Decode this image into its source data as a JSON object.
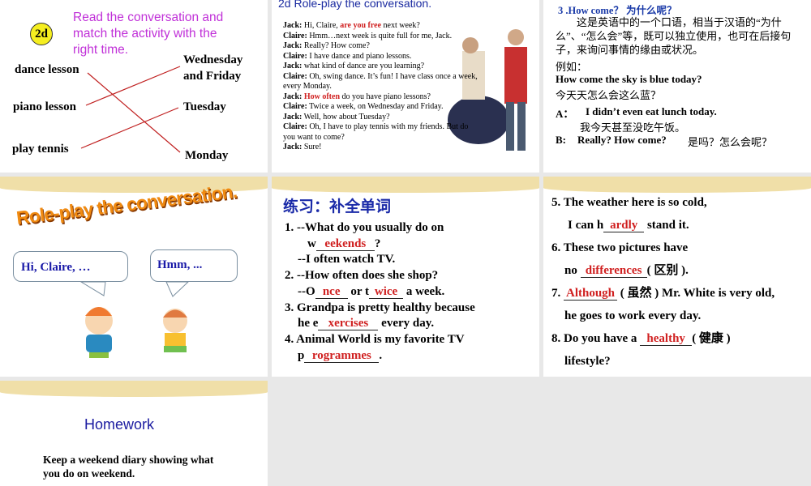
{
  "slide1": {
    "badge": "2d",
    "instruction": "Read the conversation and match the activity with the right time.",
    "activities": [
      "dance lesson",
      "piano lesson",
      "play tennis"
    ],
    "times": [
      "Wednesday and Friday",
      "Tuesday",
      "Monday"
    ]
  },
  "slide2": {
    "title": "2d Role-play the conversation.",
    "lines": [
      {
        "speaker": "Jack:",
        "pre": " Hi, Claire, ",
        "hl": "are you free",
        "post": " next week?"
      },
      {
        "speaker": "Claire:",
        "pre": " Hmm…next week is quite full for me, Jack.",
        "hl": "",
        "post": ""
      },
      {
        "speaker": "Jack:",
        "pre": " Really? How come?",
        "hl": "",
        "post": ""
      },
      {
        "speaker": "Claire:",
        "pre": " I have dance and piano lessons.",
        "hl": "",
        "post": ""
      },
      {
        "speaker": "Jack:",
        "pre": " what kind of dance are you learning?",
        "hl": "",
        "post": ""
      },
      {
        "speaker": "Claire:",
        "pre": " Oh, swing dance. It’s fun! I have class once a week, every Monday.",
        "hl": "",
        "post": ""
      },
      {
        "speaker": "Jack:",
        "pre": " ",
        "hl": "How often",
        "post": " do you have piano lessons?"
      },
      {
        "speaker": "Claire:",
        "pre": " Twice a week, on Wednesday and Friday.",
        "hl": "",
        "post": ""
      },
      {
        "speaker": "Jack:",
        "pre": " Well, how about Tuesday?",
        "hl": "",
        "post": ""
      },
      {
        "speaker": "Claire:",
        "pre": " Oh, I have to play tennis with my friends. But do you want to come?",
        "hl": "",
        "post": ""
      },
      {
        "speaker": "Jack:",
        "pre": " Sure!",
        "hl": "",
        "post": ""
      }
    ]
  },
  "slide3": {
    "title": "3 .How come？ 为什么呢？",
    "para": "这是英语中的一个口语，相当于汉语的“为什么”、“怎么会”等，既可以独立使用，也可在后接句子，来询问事情的缘由或状况。",
    "eg": "例如：",
    "ex1": "How come the sky is blue today?",
    "ex1_cn": "今天天怎么会这么蓝？",
    "a_label": "A：",
    "a_text": "I didn’t even eat lunch today.",
    "a_cn": "我今天甚至没吃午饭。",
    "b_label": "B:",
    "b_text": "Really? How come?",
    "b_cn": "是吗？怎么会呢？"
  },
  "slide4": {
    "title": "Role-play the conversation.",
    "bubble1": "Hi, Claire, …",
    "bubble2": "Hmm, ..."
  },
  "slide5": {
    "title": "练习：补全单词",
    "q1a": "1. --What do you usually do on",
    "q1_pre": "w",
    "q1_ans": "eekends",
    "q1_post": "?",
    "q1b": "--I often watch TV.",
    "q2a": "2. --How often does she shop?",
    "q2_pre": "--O",
    "q2_ans1": "nce",
    "q2_mid": " or t",
    "q2_ans2": "wice",
    "q2_post": " a week.",
    "q3a": "3. Grandpa is pretty healthy because",
    "q3_pre": "he e",
    "q3_ans": "xercises",
    "q3_post": " every day.",
    "q4a": "4. Animal World is my favorite TV",
    "q4_pre": "p",
    "q4_ans": "rogrammes",
    "q4_post": "."
  },
  "slide6": {
    "q5a": "5. The weather here is so cold,",
    "q5_pre": "I can h",
    "q5_ans": "ardly",
    "q5_post": " stand it.",
    "q6a": "6. These two pictures have",
    "q6_pre": "no ",
    "q6_ans": "differences",
    "q6_post": "( 区别 ).",
    "q7_pre": "7. ",
    "q7_ans": "Although",
    "q7_post": " ( 虽然 ) Mr. White is very old,",
    "q7b": "he goes to work every day.",
    "q8_pre": "8. Do you have a ",
    "q8_ans": "healthy",
    "q8_post": "( 健康 )",
    "q8b": "lifestyle?"
  },
  "slide7": {
    "title": "Homework",
    "text1": "Keep a weekend diary showing what",
    "text2": "you do on weekend."
  }
}
